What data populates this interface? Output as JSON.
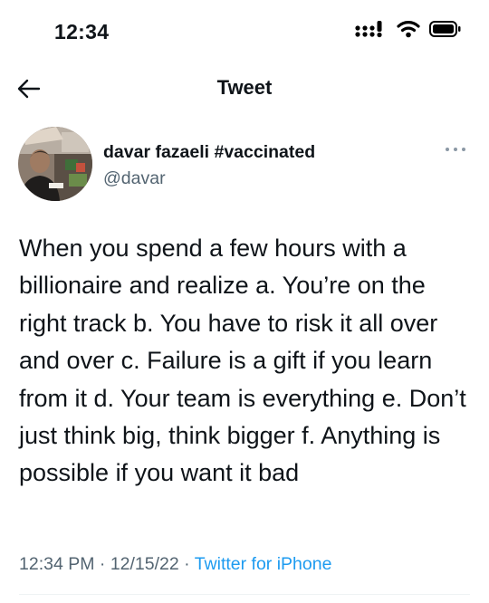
{
  "status_bar": {
    "time": "12:34",
    "signal_text": ":::!"
  },
  "header": {
    "title": "Tweet"
  },
  "tweet": {
    "author_name": "davar fazaeli #vaccinated",
    "author_handle": "@davar",
    "text": "When you spend a few hours with a billionaire and realize a. You’re on the right track b. You have to risk it all over and over c. Failure is a gift if you learn from it d. Your team is everything e. Don’t just think big, think bigger f. Anything is possible if you want it bad",
    "time": "12:34 PM",
    "separator": " · ",
    "date": "12/15/22",
    "source": "Twitter for iPhone"
  },
  "colors": {
    "link": "#1d9bf0",
    "secondary_text": "#536471",
    "text": "#0f1419"
  }
}
